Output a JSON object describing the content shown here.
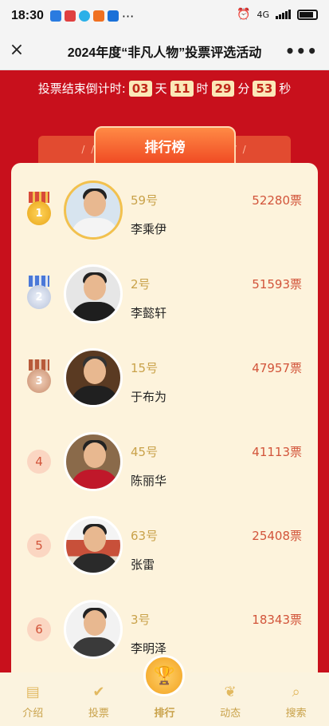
{
  "status_bar": {
    "time": "18:30",
    "network": "4G",
    "more_apps": "···"
  },
  "title_bar": {
    "title": "2024年度“非凡人物”投票评选活动",
    "close_icon": "×",
    "more_icon": "•••"
  },
  "countdown": {
    "label": "投票结束倒计时:",
    "days": "03",
    "day_unit": "天",
    "hours": "11",
    "hour_unit": "时",
    "minutes": "29",
    "minute_unit": "分",
    "seconds": "53",
    "second_unit": "秒"
  },
  "ranking": {
    "tab_label": "排行榜",
    "entries": [
      {
        "rank": "1",
        "number": "59号",
        "name": "李乘伊",
        "votes": "52280票"
      },
      {
        "rank": "2",
        "number": "2号",
        "name": "李懿轩",
        "votes": "51593票"
      },
      {
        "rank": "3",
        "number": "15号",
        "name": "于布为",
        "votes": "47957票"
      },
      {
        "rank": "4",
        "number": "45号",
        "name": "陈丽华",
        "votes": "41113票"
      },
      {
        "rank": "5",
        "number": "63号",
        "name": "张雷",
        "votes": "25408票"
      },
      {
        "rank": "6",
        "number": "3号",
        "name": "李明泽",
        "votes": "18343票"
      }
    ]
  },
  "bottom_nav": {
    "intro": "介绍",
    "vote": "投票",
    "rank": "排行",
    "news": "动态",
    "search": "搜索"
  },
  "colors": {
    "primary_red": "#c8101c",
    "gold": "#c9a24a",
    "vote_red": "#d2543a",
    "panel": "#fdf3dc"
  }
}
